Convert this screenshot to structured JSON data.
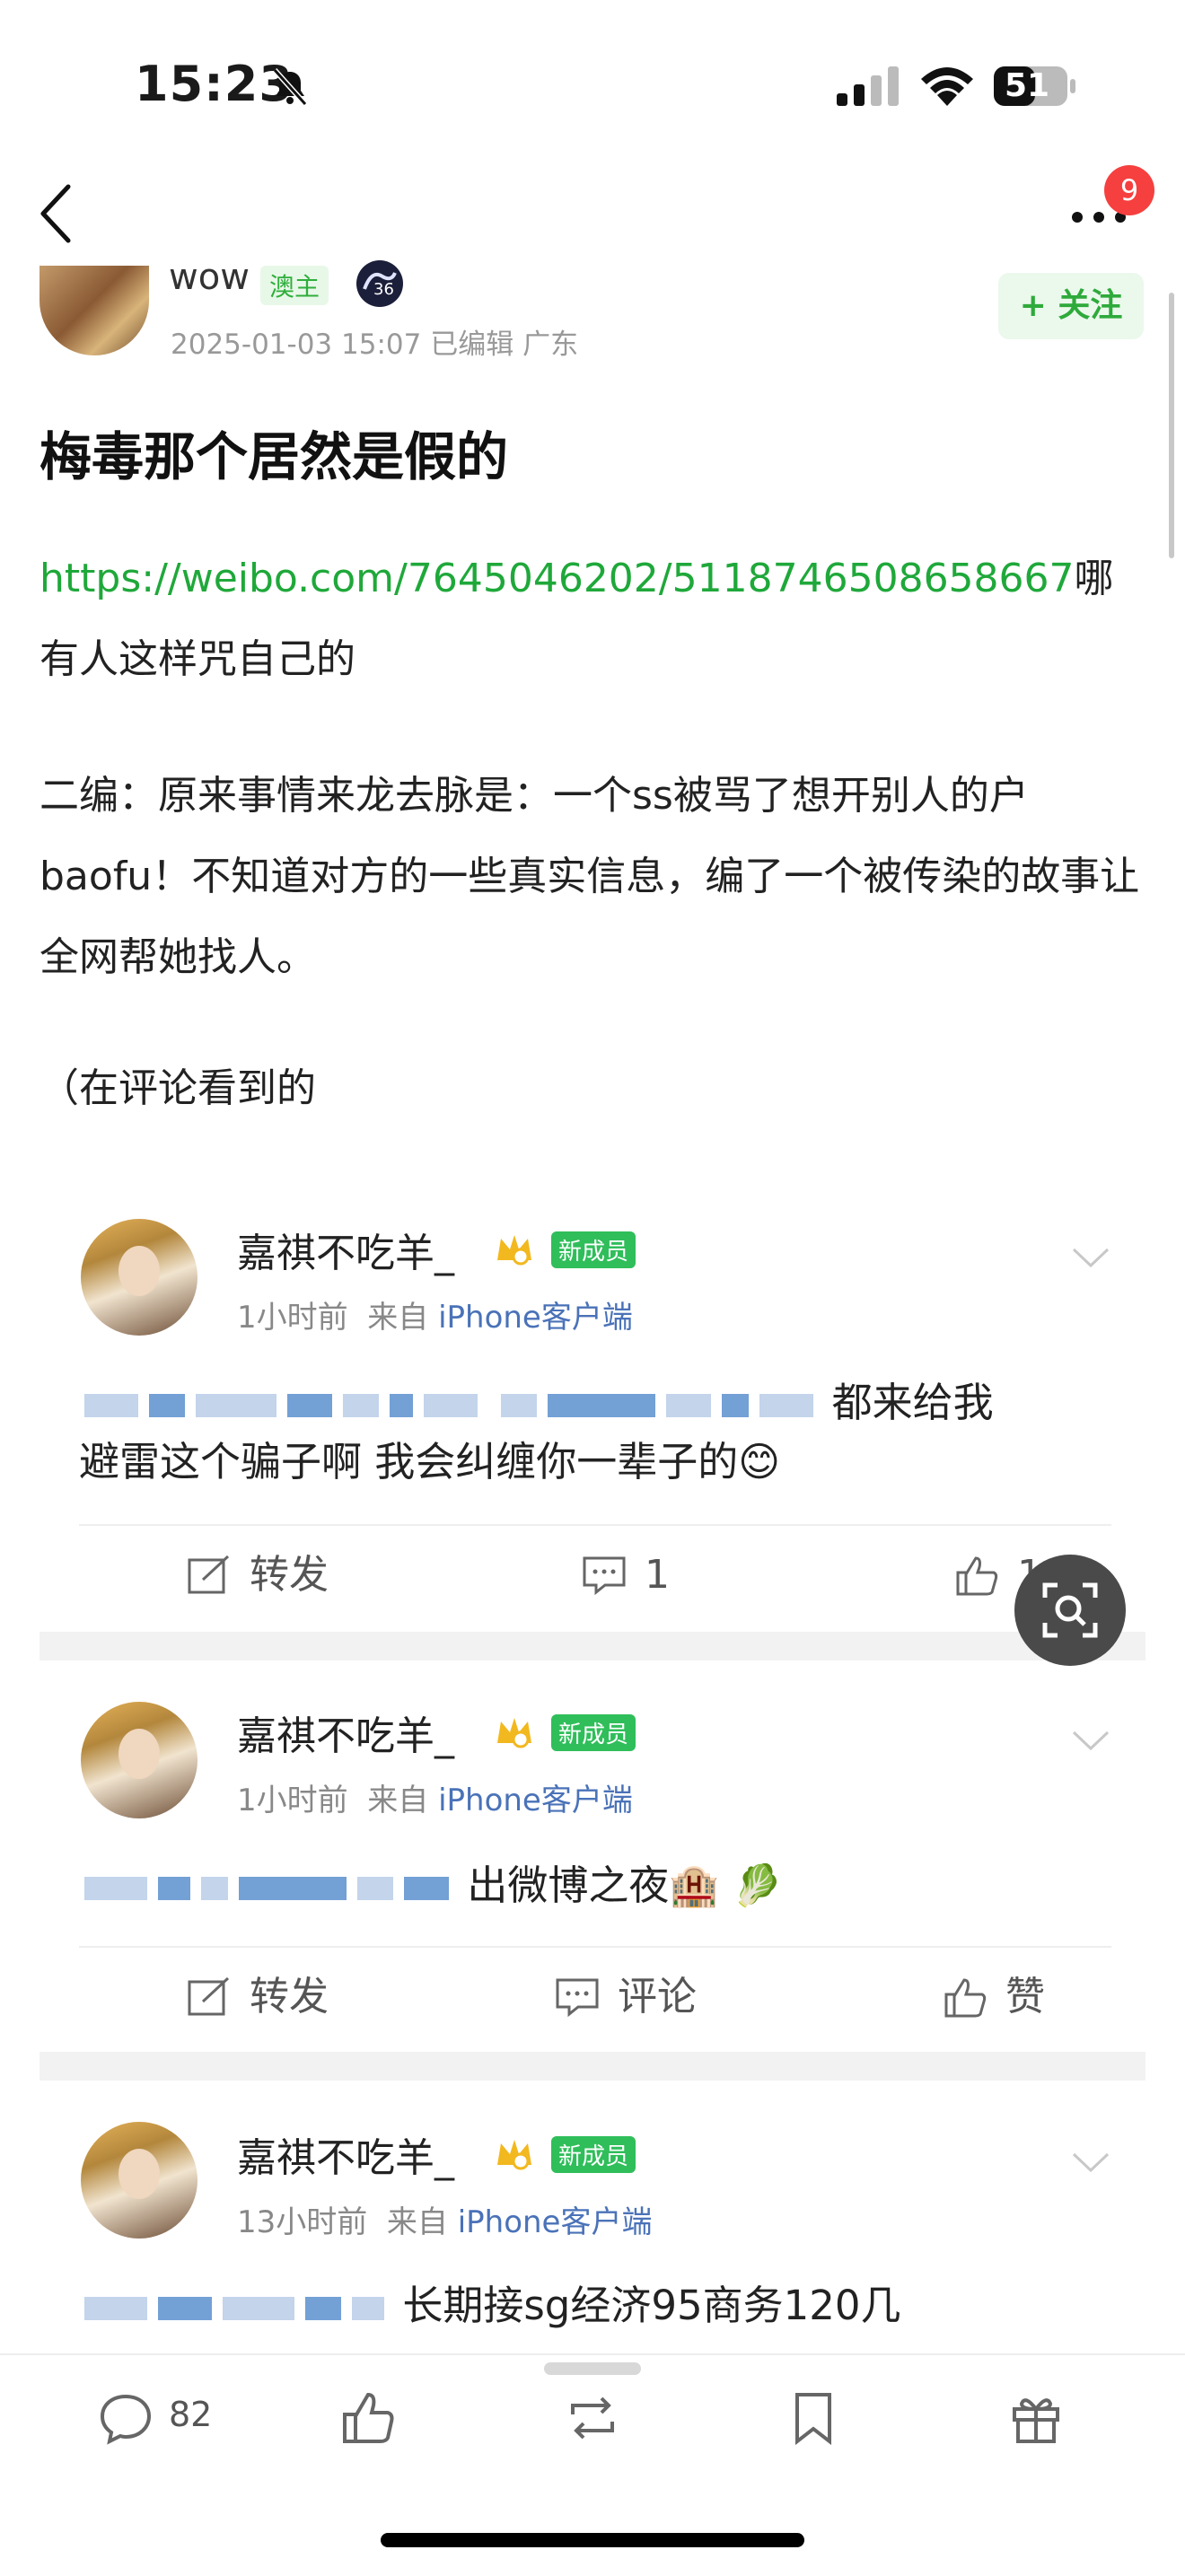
{
  "status_bar": {
    "time": "15:23",
    "battery": "51"
  },
  "nav": {
    "notification_count": "9"
  },
  "author": {
    "name": "wow",
    "badge": "澳主",
    "timestamp": "2025-01-03 15:07",
    "edited": "已编辑",
    "location": "广东",
    "follow_label": "+ 关注"
  },
  "post": {
    "title": "梅毒那个居然是假的",
    "link": "https://weibo.com/7645046202/5118746508658667",
    "link_suffix": "哪有人这样咒自己的",
    "edit_note": "二编：原来事情来龙去脉是：一个ss被骂了想开别人的户baofu！不知道对方的一些真实信息，编了一个被传染的故事让全网帮她找人。",
    "source_note": "（在评论看到的"
  },
  "screenshot_comments": [
    {
      "user": "嘉祺不吃羊_",
      "tag": "新成员",
      "time": "1小时前",
      "from": "来自",
      "device": "iPhone客户端",
      "text_a": "都来给我",
      "text_b": "避雷这个骗子啊 我会纠缠你一辈子的😊",
      "actions": {
        "repost": "转发",
        "comment": "1",
        "like": "1"
      }
    },
    {
      "user": "嘉祺不吃羊_",
      "tag": "新成员",
      "time": "1小时前",
      "from": "来自",
      "device": "iPhone客户端",
      "text_a": "出微博之夜🏨 🥬",
      "actions": {
        "repost": "转发",
        "comment": "评论",
        "like": "赞"
      }
    },
    {
      "user": "嘉祺不吃羊_",
      "tag": "新成员",
      "time": "13小时前",
      "from": "来自",
      "device": "iPhone客户端",
      "text_a": "长期接sg经济95商务120几"
    }
  ],
  "bottom_bar": {
    "comment_count": "82"
  },
  "colors": {
    "accent_green": "#1fa83a",
    "badge_red": "#f5403f",
    "device_blue": "#4a72b8"
  }
}
